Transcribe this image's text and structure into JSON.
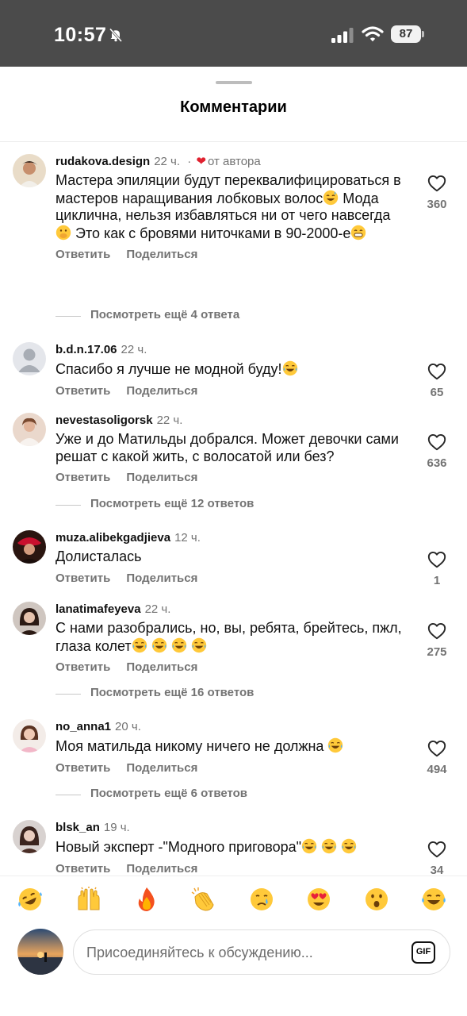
{
  "status_bar": {
    "time": "10:57",
    "battery": "87"
  },
  "sheet": {
    "title": "Комментарии"
  },
  "comments": [
    {
      "username": "rudakova.design",
      "time": "22 ч.",
      "author_separator": "·",
      "author_label": "от автора",
      "text_parts": [
        "Мастера эпиляции будут переквалифицироваться в мастеров наращивания лобковых волос",
        " Мода циклична, нельзя избавляться ни от чего навсегда",
        " Это как с бровями ниточками в 90-2000-е"
      ],
      "likes": "360",
      "more_replies": "Посмотреть ещё 4 ответа"
    },
    {
      "username": "b.d.n.17.06",
      "time": "22 ч.",
      "text": "Спасибо я лучше не модной буду!",
      "likes": "65"
    },
    {
      "username": "nevestasoligorsk",
      "time": "22 ч.",
      "text": "Уже и до Матильды добрался. Может девочки сами решат с какой жить, с волосатой или без?",
      "likes": "636",
      "more_replies": "Посмотреть ещё 12 ответов"
    },
    {
      "username": "muza.alibekgadjieva",
      "time": "12 ч.",
      "text": "Долисталась",
      "likes": "1"
    },
    {
      "username": "lanatimafeyeva",
      "time": "22 ч.",
      "text": "С нами разобрались, но, вы, ребята, брейтесь, пжл, глаза колет",
      "likes": "275",
      "more_replies": "Посмотреть ещё 16 ответов"
    },
    {
      "username": "no_anna1",
      "time": "20 ч.",
      "text": "Моя матильда никому ничего не должна ",
      "likes": "494",
      "more_replies": "Посмотреть ещё 6 ответов"
    },
    {
      "username": "blsk_an",
      "time": "19 ч.",
      "text": "Новый эксперт -\"Модного приговора\"",
      "likes": "34"
    }
  ],
  "actions": {
    "reply": "Ответить",
    "share": "Поделиться"
  },
  "emoji_bar": [
    "rofl-emoji",
    "raising-hands-emoji",
    "fire-emoji",
    "clapping-hands-emoji",
    "crying-face-emoji",
    "heart-eyes-emoji",
    "surprised-face-emoji",
    "tears-of-joy-emoji"
  ],
  "composer": {
    "placeholder": "Присоединяйтесь к обсуждению...",
    "gif_label": "GIF"
  },
  "colors": {
    "accent_heart": "#e0212f",
    "muted_text": "#737373",
    "backdrop": "#4b4b4b"
  }
}
